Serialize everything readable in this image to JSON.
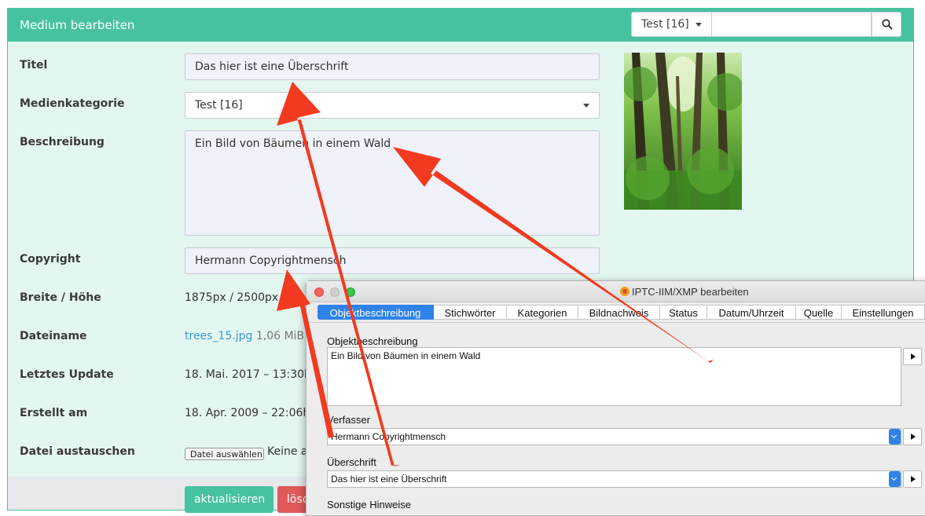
{
  "panel": {
    "title": "Medium bearbeiten",
    "category_button": "Test [16]",
    "search": {
      "value": "",
      "placeholder": ""
    }
  },
  "form": {
    "title_label": "Titel",
    "title_value": "Das hier ist eine Überschrift",
    "category_label": "Medienkategorie",
    "category_value": "Test [16]",
    "description_label": "Beschreibung",
    "description_value": "Ein Bild von Bäumen in einem Wald",
    "copyright_label": "Copyright",
    "copyright_value": "Hermann Copyrightmensch",
    "dimensions_label": "Breite / Höhe",
    "dimensions_value": "1875px / 2500px",
    "filename_label": "Dateiname",
    "filename_value": "trees_15.jpg",
    "filesize_value": "1,06 MiB",
    "updated_label": "Letztes Update",
    "updated_value": "18. Mai. 2017 – 13:30h",
    "created_label": "Erstellt am",
    "created_value": "18. Apr. 2009 – 22:06h",
    "replace_label": "Datei austauschen",
    "file_choose_button": "Datei auswählen",
    "file_none": "Keine a",
    "update_button": "aktualisieren",
    "delete_button": "lösc"
  },
  "dialog": {
    "title": "IPTC-IIM/XMP bearbeiten",
    "tabs": [
      "Objektbeschreibung",
      "Stichwörter",
      "Kategorien",
      "Bildnachweis",
      "Status",
      "Datum/Uhrzeit",
      "Quelle",
      "Einstellungen"
    ],
    "active_tab": 0,
    "description_label": "Objektbeschreibung",
    "description_value": "Ein Bild von Bäumen in einem Wald",
    "author_label": "Verfasser",
    "author_value": "Hermann Copyrightmensch",
    "headline_label": "Überschrift",
    "headline_value": "Das hier ist eine Überschrift",
    "notes_label": "Sonstige Hinweise"
  },
  "colors": {
    "header": "#47c2a1",
    "panel_bg": "#e3f6ef",
    "link": "#3a9ad9",
    "delete": "#e05a5a",
    "dialog_accent": "#2f83e6",
    "annotation_arrow": "#f23a20"
  },
  "icons": {
    "search": "search-icon",
    "caret": "caret-down-icon",
    "thumbnail": "forest-photo",
    "dialog_app": "app-icon"
  }
}
